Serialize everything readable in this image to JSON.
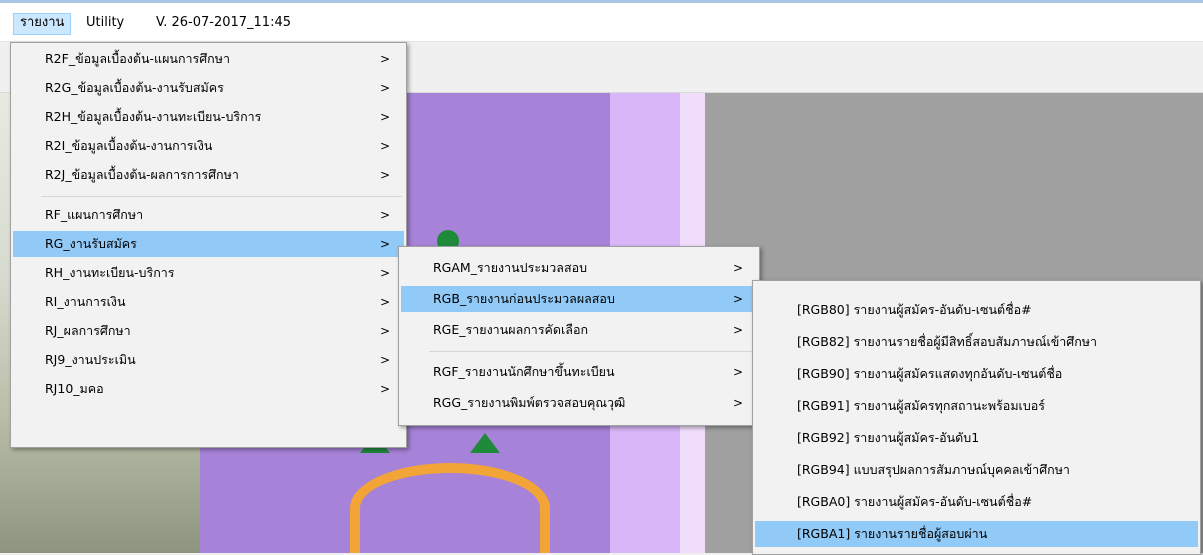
{
  "menubar": {
    "items": [
      {
        "label": "รายงาน",
        "active": true
      },
      {
        "label": "Utility",
        "active": false
      }
    ],
    "version": "V. 26-07-2017_11:45"
  },
  "menu1": {
    "items": [
      {
        "label": "R2F_ข้อมูลเบื้องต้น-แผนการศึกษา",
        "arrow": ">"
      },
      {
        "label": "R2G_ข้อมูลเบื้องต้น-งานรับสมัคร",
        "arrow": ">"
      },
      {
        "label": "R2H_ข้อมูลเบื้องต้น-งานทะเบียน-บริการ",
        "arrow": ">"
      },
      {
        "label": "R2I_ข้อมูลเบื้องต้น-งานการเงิน",
        "arrow": ">"
      },
      {
        "label": "R2J_ข้อมูลเบื้องต้น-ผลการการศึกษา",
        "arrow": ">"
      },
      {
        "label": "RF_แผนการศึกษา",
        "arrow": ">"
      },
      {
        "label": "RG_งานรับสมัคร",
        "arrow": ">"
      },
      {
        "label": "RH_งานทะเบียน-บริการ",
        "arrow": ">"
      },
      {
        "label": "RI_งานการเงิน",
        "arrow": ">"
      },
      {
        "label": "RJ_ผลการศึกษา",
        "arrow": ">"
      },
      {
        "label": "RJ9_งานประเมิน",
        "arrow": ">"
      },
      {
        "label": "RJ10_มคอ",
        "arrow": ">"
      }
    ]
  },
  "menu2": {
    "items": [
      {
        "label": "RGAM_รายงานประมวลสอบ",
        "arrow": ">"
      },
      {
        "label": "RGB_รายงานก่อนประมวลผลสอบ",
        "arrow": ">"
      },
      {
        "label": "RGE_รายงานผลการคัดเลือก",
        "arrow": ">"
      },
      {
        "label": "RGF_รายงานนักศึกษาขึ้นทะเบียน",
        "arrow": ">"
      },
      {
        "label": "RGG_รายงานพิมพ์ตรวจสอบคุณวุฒิ",
        "arrow": ">"
      }
    ]
  },
  "menu3": {
    "items": [
      {
        "label": "[RGB80] รายงานผู้สมัคร-อันดับ-เซนต์ชื่อ#"
      },
      {
        "label": "[RGB82] รายงานรายชื่อผู้มีสิทธิ์สอบสัมภาษณ์เข้าศึกษา"
      },
      {
        "label": "[RGB90] รายงานผู้สมัครแสดงทุกอันดับ-เซนต์ชื่อ"
      },
      {
        "label": "[RGB91] รายงานผู้สมัครทุกสถานะพร้อมเบอร์"
      },
      {
        "label": "[RGB92] รายงานผู้สมัคร-อันดับ1"
      },
      {
        "label": "[RGB94] แบบสรุปผลการสัมภาษณ์บุคคลเข้าศึกษา"
      },
      {
        "label": "[RGBA0] รายงานผู้สมัคร-อันดับ-เซนต์ชื่อ#"
      },
      {
        "label": "[RGBA1] รายงานรายชื่อผู้สอบผ่าน"
      }
    ]
  }
}
